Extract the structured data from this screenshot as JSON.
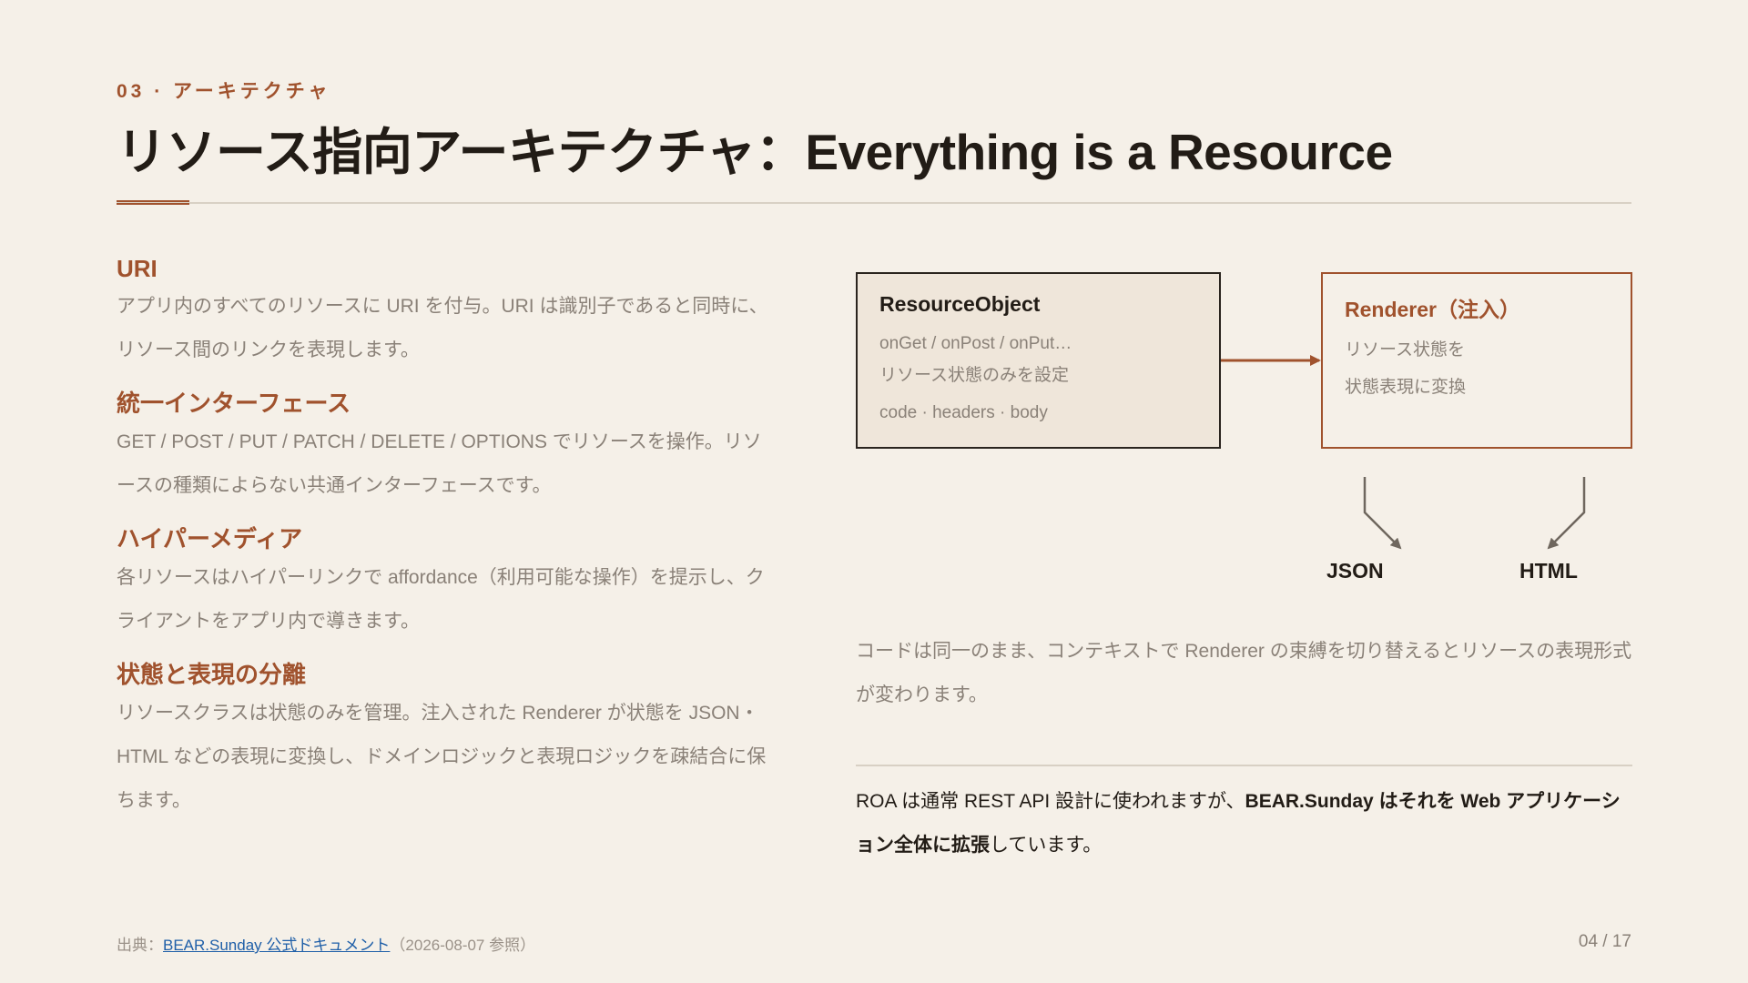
{
  "header": {
    "eyebrow": "03 · アーキテクチャ",
    "title": "リソース指向アーキテクチャ：Everything is a Resource"
  },
  "sections": [
    {
      "heading": "URI",
      "text": "アプリ内のすべてのリソースに URI を付与。URI は識別子であると同時に、リソース間のリンクを表現します。"
    },
    {
      "heading": "統一インターフェース",
      "text": "GET / POST / PUT / PATCH / DELETE / OPTIONS でリソースを操作。リソースの種類によらない共通インターフェースです。"
    },
    {
      "heading": "ハイパーメディア",
      "text": "各リソースはハイパーリンクで affordance（利用可能な操作）を提示し、クライアントをアプリ内で導きます。"
    },
    {
      "heading": "状態と表現の分離",
      "text": "リソースクラスは状態のみを管理。注入された Renderer が状態を JSON・HTML などの表現に変換し、ドメインロジックと表現ロジックを疎結合に保ちます。"
    }
  ],
  "diagram": {
    "resource_box": {
      "title": "ResourceObject",
      "line1": "onGet / onPost / onPut…",
      "line2": "リソース状態のみを設定",
      "line3": "code · headers · body"
    },
    "renderer_box": {
      "title": "Renderer（注入）",
      "line1": "リソース状態を",
      "line2": "状態表現に変換"
    },
    "outputs": [
      "JSON",
      "HTML"
    ]
  },
  "caption": "コードは同一のまま、コンテキストで Renderer の束縛を切り替えるとリソースの表現形式が変わります。",
  "note": {
    "prefix": "ROA は通常 REST API 設計に使われますが、",
    "bold": "BEAR.Sunday はそれを Web アプリケーション全体に拡張",
    "suffix": "しています。"
  },
  "footer": {
    "source_label": "出典：",
    "source_link": "BEAR.Sunday 公式ドキュメント",
    "source_date": "（2026-08-07 参照）",
    "page": "04 / 17"
  },
  "colors": {
    "background": "#f5f0e8",
    "accent": "#a0522d",
    "muted_text": "#8a8178",
    "link": "#1f5fa8"
  }
}
